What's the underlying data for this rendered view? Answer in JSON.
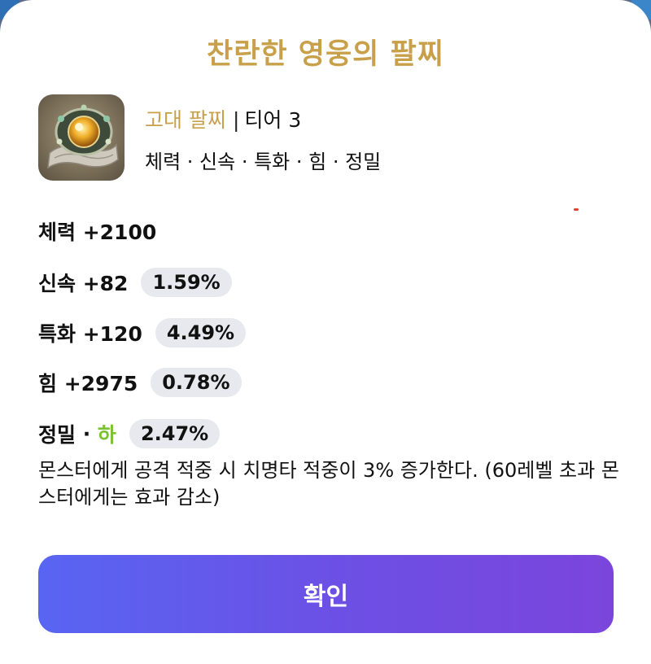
{
  "title": "찬란한 영웅의 팔찌",
  "item": {
    "icon_name": "ancient-bracelet-icon",
    "grade": "고대 팔찌",
    "separator": "|",
    "tier": "티어 3",
    "stat_summary": "체력 · 신속 · 특화 · 힘 · 정밀"
  },
  "stats": [
    {
      "label": "체력 +2100",
      "percent": ""
    },
    {
      "label": "신속 +82",
      "percent": "1.59%"
    },
    {
      "label": "특화 +120",
      "percent": "4.49%"
    },
    {
      "label": "힘 +2975",
      "percent": "0.78%"
    }
  ],
  "special_effect": {
    "name": "정밀",
    "dot": " · ",
    "grade": "하",
    "percent": "2.47%",
    "description": "몬스터에게 공격 적중 시 치명타 적중이 3% 증가한다. (60레벨 초과 몬스터에게는 효과 감소)"
  },
  "confirm_label": "확인",
  "colors": {
    "title_gold": "#c9a04a",
    "grade_low_green": "#7ac231",
    "pill_bg": "#e8e9ee",
    "button_gradient_start": "#5865f2",
    "button_gradient_end": "#7b45dc"
  }
}
